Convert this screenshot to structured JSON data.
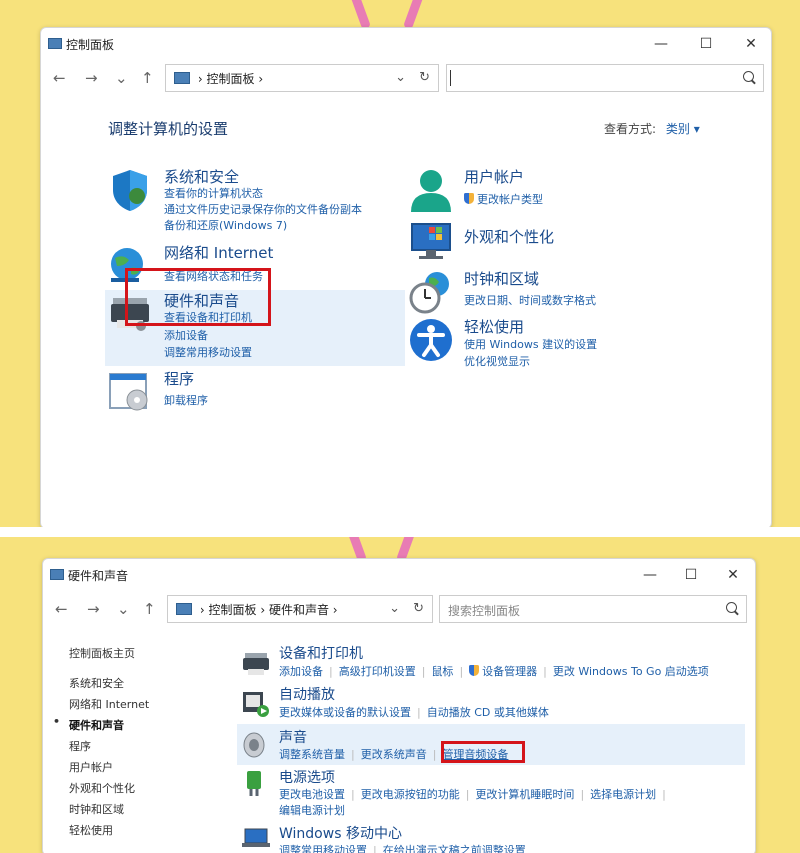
{
  "top": {
    "window_title": "控制面板",
    "window_controls": {
      "minimize": "—",
      "maximize": "☐",
      "close": "✕"
    },
    "nav": {
      "back": "←",
      "forward": "→",
      "recent": "⌄",
      "up": "↑",
      "refresh": "↻",
      "dropdown": "⌄"
    },
    "breadcrumb": {
      "root_sep": "›",
      "current": "控制面板",
      "trail_sep": "›"
    },
    "heading": "调整计算机的设置",
    "view_by": {
      "label": "查看方式:",
      "value": "类别 ▾"
    },
    "categories": [
      {
        "title": "系统和安全",
        "links": [
          "查看你的计算机状态",
          "通过文件历史记录保存你的文件备份副本",
          "备份和还原(Windows 7)"
        ],
        "icon": "shield-icon"
      },
      {
        "title": "网络和 Internet",
        "links": [
          "查看网络状态和任务"
        ],
        "icon": "network-globe-icon"
      },
      {
        "title": "硬件和声音",
        "links": [
          "查看设备和打印机",
          "添加设备",
          "调整常用移动设置"
        ],
        "icon": "printer-icon"
      },
      {
        "title": "程序",
        "links": [
          "卸载程序"
        ],
        "icon": "programs-icon"
      },
      {
        "title": "用户帐户",
        "links": [
          "更改帐户类型"
        ],
        "icon": "user-icon"
      },
      {
        "title": "外观和个性化",
        "links": [],
        "icon": "monitor-icon"
      },
      {
        "title": "时钟和区域",
        "links": [
          "更改日期、时间或数字格式"
        ],
        "icon": "clock-globe-icon"
      },
      {
        "title": "轻松使用",
        "links": [
          "使用 Windows 建议的设置",
          "优化视觉显示"
        ],
        "icon": "accessibility-icon"
      }
    ]
  },
  "bottom": {
    "window_title": "硬件和声音",
    "window_controls": {
      "minimize": "—",
      "maximize": "☐",
      "close": "✕"
    },
    "nav": {
      "back": "←",
      "forward": "→",
      "recent": "⌄",
      "up": "↑",
      "refresh": "↻",
      "dropdown": "⌄"
    },
    "breadcrumb": {
      "sep1": "›",
      "item1": "控制面板",
      "sep2": "›",
      "item2": "硬件和声音",
      "sep3": "›"
    },
    "search_placeholder": "搜索控制面板",
    "sidebar": {
      "home": "控制面板主页",
      "items": [
        "系统和安全",
        "网络和 Internet",
        "硬件和声音",
        "程序",
        "用户帐户",
        "外观和个性化",
        "时钟和区域",
        "轻松使用"
      ],
      "active_bullet": "•"
    },
    "sections": [
      {
        "title": "设备和打印机",
        "links": [
          "添加设备",
          "高级打印机设置",
          "鼠标",
          "设备管理器",
          "更改 Windows To Go 启动选项"
        ]
      },
      {
        "title": "自动播放",
        "links": [
          "更改媒体或设备的默认设置",
          "自动播放 CD 或其他媒体"
        ]
      },
      {
        "title": "声音",
        "links": [
          "调整系统音量",
          "更改系统声音",
          "管理音频设备"
        ]
      },
      {
        "title": "电源选项",
        "links": [
          "更改电池设置",
          "更改电源按钮的功能",
          "更改计算机睡眠时间",
          "选择电源计划",
          "编辑电源计划"
        ]
      },
      {
        "title": "Windows 移动中心",
        "links": [
          "调整常用移动设置",
          "在给出演示文稿之前调整设置"
        ]
      }
    ]
  },
  "colors": {
    "background": "#f7e27c",
    "accent_link": "#1f5fa8",
    "highlight_box": "#d4141a",
    "selected_row": "#e6f0fa"
  }
}
